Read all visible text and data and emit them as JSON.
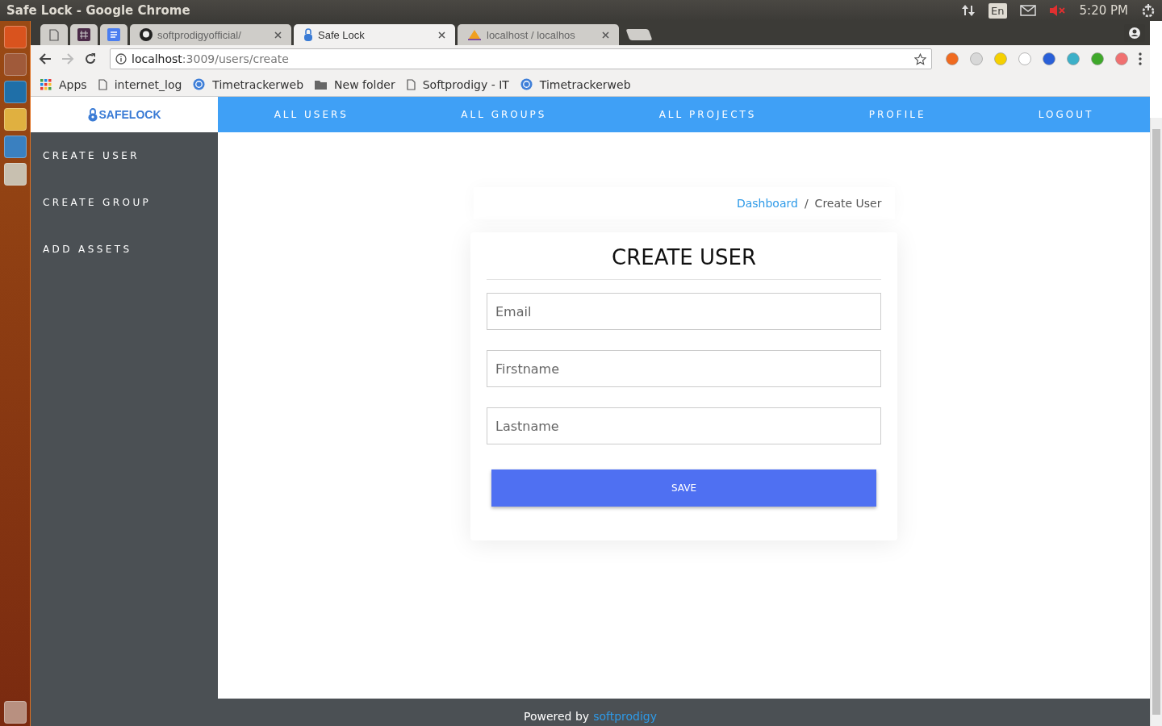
{
  "os_bar": {
    "title": "Safe Lock - Google Chrome",
    "keyboard": "En",
    "time": "5:20 PM"
  },
  "tabs": [
    {
      "kind": "page",
      "selected": false
    },
    {
      "kind": "hash",
      "selected": false
    },
    {
      "kind": "doc",
      "selected": false
    },
    {
      "kind": "github",
      "label": "softprodigyofficial/",
      "selected": false
    },
    {
      "kind": "lock",
      "label": "Safe Lock",
      "selected": true
    },
    {
      "kind": "pma",
      "label": "localhost / localhos",
      "selected": false
    }
  ],
  "address": {
    "host": "localhost",
    "path": ":3009/users/create"
  },
  "bookmarks": [
    {
      "kind": "apps",
      "label": "Apps"
    },
    {
      "kind": "page",
      "label": "internet_log"
    },
    {
      "kind": "clock",
      "label": "Timetrackerweb"
    },
    {
      "kind": "folder",
      "label": "New folder"
    },
    {
      "kind": "page",
      "label": "Softprodigy - IT"
    },
    {
      "kind": "clock",
      "label": "Timetrackerweb"
    }
  ],
  "sidebar": {
    "logo": "SAFELOCK",
    "items": [
      "CREATE USER",
      "CREATE GROUP",
      "ADD ASSETS"
    ]
  },
  "nav": [
    "ALL USERS",
    "ALL GROUPS",
    "ALL PROJECTS",
    "PROFILE",
    "LOGOUT"
  ],
  "breadcrumb": {
    "link": "Dashboard",
    "separator": "/",
    "current": "Create User"
  },
  "form": {
    "title": "CREATE USER",
    "fields": [
      {
        "placeholder": "Email"
      },
      {
        "placeholder": "Firstname"
      },
      {
        "placeholder": "Lastname"
      }
    ],
    "button": "SAVE"
  },
  "footer": {
    "text": "Powered by",
    "link": "softprodigy"
  }
}
